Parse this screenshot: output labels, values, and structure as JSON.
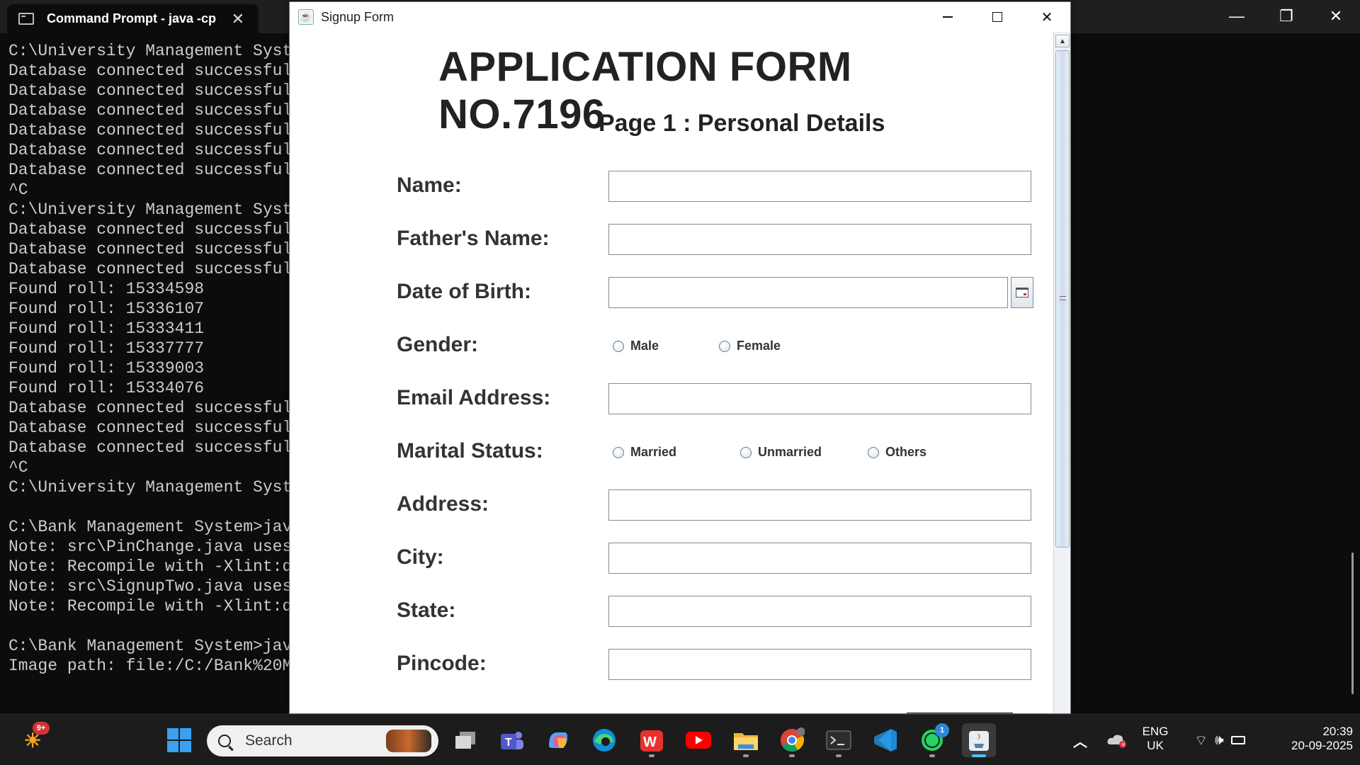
{
  "terminal": {
    "tab_title": "Command Prompt - java  -cp",
    "close_glyph": "✕",
    "lines": [
      "C:\\University Management Syst",
      "Database connected successful",
      "Database connected successful",
      "Database connected successful",
      "Database connected successful",
      "Database connected successful",
      "Database connected successful",
      "^C",
      "C:\\University Management Syst",
      "Database connected successful",
      "Database connected successful",
      "Database connected successful",
      "Found roll: 15334598",
      "Found roll: 15336107",
      "Found roll: 15333411",
      "Found roll: 15337777",
      "Found roll: 15339003",
      "Found roll: 15334076",
      "Database connected successful",
      "Database connected successful",
      "Database connected successful",
      "^C",
      "C:\\University Management Syst",
      "",
      "C:\\Bank Management System>jav",
      "Note: src\\PinChange.java uses",
      "Note: Recompile with -Xlint:d",
      "Note: src\\SignupTwo.java uses",
      "Note: Recompile with -Xlint:d",
      "",
      "C:\\Bank Management System>jav",
      "Image path: file:/C:/Bank%20M"
    ]
  },
  "window": {
    "title": "Signup Form",
    "close_glyph": "✕"
  },
  "form": {
    "title": "APPLICATION FORM NO.7196",
    "subtitle": "Page 1 : Personal Details",
    "labels": {
      "name": "Name:",
      "father_name": "Father's Name:",
      "dob": "Date of Birth:",
      "gender": "Gender:",
      "email": "Email Address:",
      "marital": "Marital Status:",
      "address": "Address:",
      "city": "City:",
      "state": "State:",
      "pincode": "Pincode:"
    },
    "values": {
      "name": "",
      "father_name": "",
      "dob": "",
      "email": "",
      "address": "",
      "city": "",
      "state": "",
      "pincode": ""
    },
    "gender_options": [
      "Male",
      "Female"
    ],
    "marital_options": [
      "Married",
      "Unmarried",
      "Others"
    ]
  },
  "taskbar": {
    "search_label": "Search",
    "widget_badge": "9+",
    "teams_badge": "1",
    "whatsapp_badge": "1",
    "language_line1": "ENG",
    "language_line2": "UK",
    "time": "20:39",
    "date": "20-09-2025",
    "apps": [
      "widgets",
      "start",
      "search",
      "task-view",
      "teams",
      "copilot",
      "edge",
      "wps-office",
      "youtube",
      "file-explorer",
      "chrome",
      "terminal",
      "vscode",
      "whatsapp",
      "java"
    ]
  }
}
